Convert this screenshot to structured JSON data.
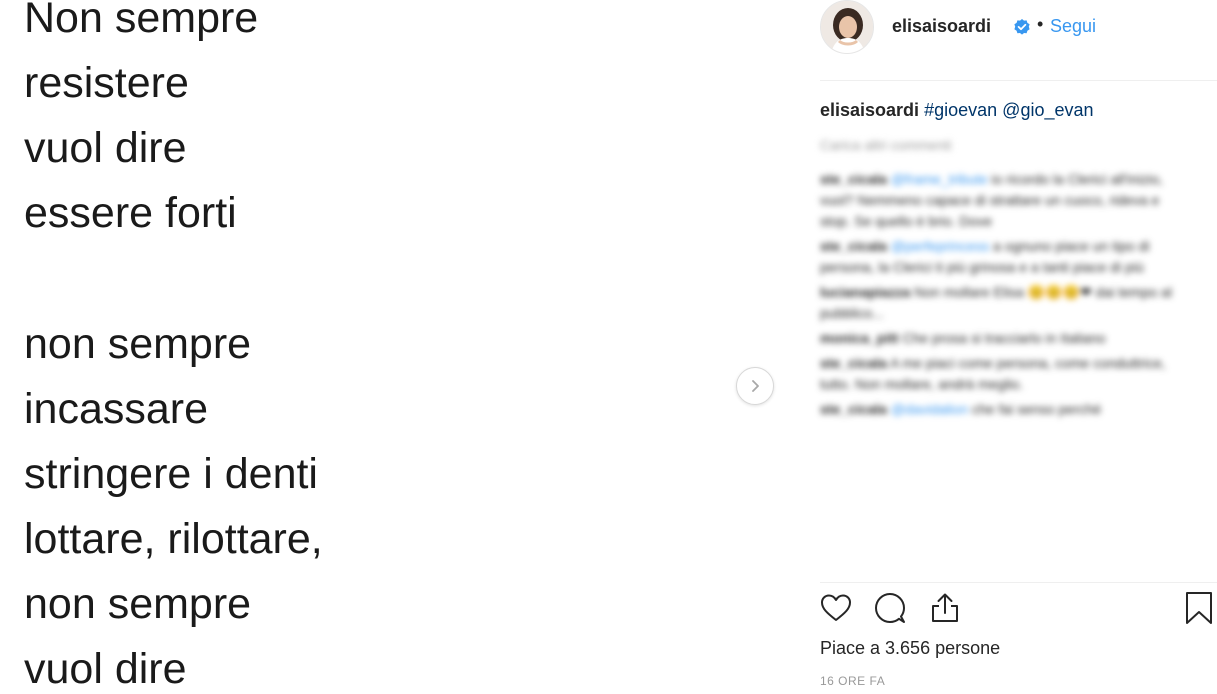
{
  "poem": {
    "lines": [
      "Non sempre",
      "resistere",
      "vuol dire",
      "essere forti",
      "",
      "non sempre",
      "incassare",
      "stringere i denti",
      "lottare, rilottare,",
      "non sempre",
      "vuol dire"
    ]
  },
  "carousel": {
    "next_icon": "chevron-right-icon"
  },
  "header": {
    "username": "elisaisoardi",
    "dot": "•",
    "follow_label": "Segui",
    "verified_icon": "verified-badge-icon"
  },
  "caption": {
    "username": "elisaisoardi",
    "hashtag": "#gioevan",
    "mention": "@gio_evan"
  },
  "comments": {
    "load_more": "Carica altri commenti",
    "items": [
      {
        "user": "ste_cicala",
        "mention": "@frame_tribute",
        "text": " io ricordo la Clerici all'inizio, vuol? Nemmeno capace di strattare un cuoco, rideva e stop. Se quello è brio. Dove"
      },
      {
        "user": "ste_cicala",
        "mention": "@perfeprincess",
        "text": " a ognuno piace un tipo di persona, la Clerici ti più grinosa e a tanti piace di più"
      },
      {
        "user": "lucianapiazza",
        "mention": "",
        "text": " Non mollare Elisa 😊😊😊❤ dai tempo al pubblico..."
      },
      {
        "user": "monica_pitt",
        "mention": "",
        "text": " Che prosa si tracciarlo in Italiano"
      },
      {
        "user": "ste_cicala",
        "mention": "",
        "text": " A me piaci come persona, come conduttrice, tutto. Non mollare, andrà meglio."
      },
      {
        "user": "ste_cicala",
        "mention": "@davidalion",
        "text": " che fai senso perché"
      }
    ]
  },
  "actions": {
    "like_icon": "heart-icon",
    "comment_icon": "comment-icon",
    "share_icon": "share-icon",
    "save_icon": "bookmark-icon"
  },
  "likes_text": "Piace a 3.656 persone",
  "timestamp": "16 ORE FA",
  "colors": {
    "link_blue": "#3897f0",
    "hashtag_blue": "#003569",
    "text": "#262626",
    "muted": "#999999",
    "border": "#efefef"
  }
}
